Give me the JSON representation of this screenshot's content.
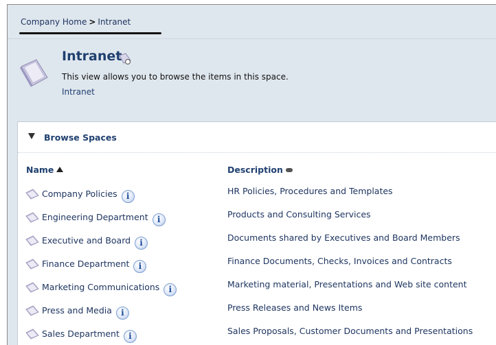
{
  "breadcrumb": {
    "home": "Company Home",
    "separator": ">",
    "current": "Intranet"
  },
  "header": {
    "title": "Intranet",
    "description": "This view allows you to browse the items in this space.",
    "subtitle": "Intranet"
  },
  "browse": {
    "title": "Browse Spaces",
    "columns": {
      "name": "Name",
      "description": "Description"
    },
    "rows": [
      {
        "name": "Company Policies",
        "description": "HR Policies, Procedures and Templates"
      },
      {
        "name": "Engineering Department",
        "description": "Products and Consulting Services"
      },
      {
        "name": "Executive and Board",
        "description": "Documents shared by Executives and Board Members"
      },
      {
        "name": "Finance Department",
        "description": "Finance Documents, Checks, Invoices and Contracts"
      },
      {
        "name": "Marketing Communications",
        "description": "Marketing material, Presentations and Web site content"
      },
      {
        "name": "Press and Media",
        "description": "Press Releases and News Items"
      },
      {
        "name": "Sales Department",
        "description": "Sales Proposals, Customer Documents and Presentations"
      }
    ]
  },
  "icons": {
    "space": "space-folder-icon",
    "title_action": "view-details-icon",
    "collapse": "collapse-triangle-icon",
    "sort": "sort-ascending-icon",
    "sort_desc_col": "sort-toggle-icon",
    "row_folder": "folder-icon",
    "row_info": "info-icon"
  },
  "colors": {
    "link": "#1e3560",
    "title": "#1f3f6f",
    "header_bg": "#dfe7ee"
  }
}
